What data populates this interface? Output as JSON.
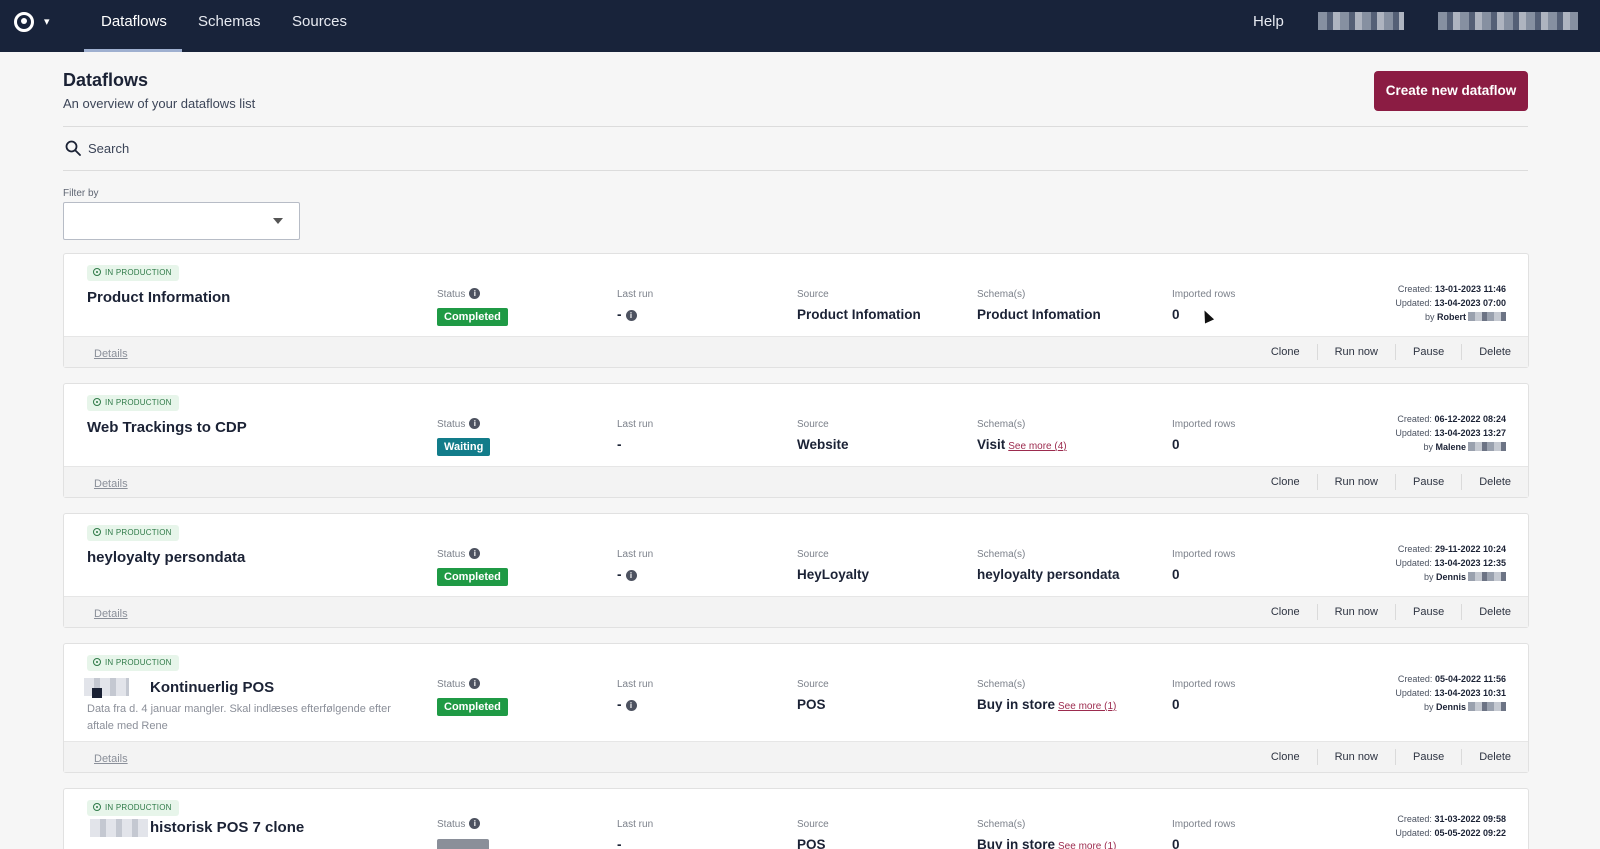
{
  "nav": {
    "tabs": [
      "Dataflows",
      "Schemas",
      "Sources"
    ],
    "help": "Help"
  },
  "header": {
    "title": "Dataflows",
    "subtitle": "An overview of your dataflows list",
    "create_button": "Create new dataflow"
  },
  "search": {
    "placeholder": "Search"
  },
  "filter": {
    "label": "Filter by",
    "value": ""
  },
  "labels": {
    "status": "Status",
    "last_run": "Last run",
    "source": "Source",
    "schemas": "Schema(s)",
    "imported_rows": "Imported rows",
    "created": "Created:",
    "updated": "Updated:",
    "by": "by",
    "details": "Details",
    "clone": "Clone",
    "run_now": "Run now",
    "pause": "Pause",
    "delete": "Delete",
    "in_production": "IN PRODUCTION"
  },
  "colors": {
    "nav_bg": "#18233a",
    "primary": "#8b1c43",
    "completed": "#1f9a45",
    "waiting": "#127c8a"
  },
  "dataflows": [
    {
      "name": "Product Information",
      "status": "Completed",
      "status_color": "#1f9a45",
      "last_run": "-",
      "source": "Product Infomation",
      "schema": "Product Infomation",
      "see_more": "",
      "imported_rows": "0",
      "created": "13-01-2023 11:46",
      "updated": "13-04-2023 07:00",
      "by": "Robert"
    },
    {
      "name": "Web Trackings to CDP",
      "status": "Waiting",
      "status_color": "#127c8a",
      "last_run": "-",
      "source": "Website",
      "schema": "Visit",
      "see_more": "See more (4)",
      "imported_rows": "0",
      "created": "06-12-2022 08:24",
      "updated": "13-04-2023 13:27",
      "by": "Malene"
    },
    {
      "name": "heyloyalty persondata",
      "status": "Completed",
      "status_color": "#1f9a45",
      "last_run": "-",
      "source": "HeyLoyalty",
      "schema": "heyloyalty persondata",
      "see_more": "",
      "imported_rows": "0",
      "created": "29-11-2022 10:24",
      "updated": "13-04-2023 12:35",
      "by": "Dennis"
    },
    {
      "name": "Kontinuerlig POS",
      "description": "Data fra d. 4 januar mangler. Skal indlæses efterfølgende efter aftale med Rene",
      "status": "Completed",
      "status_color": "#1f9a45",
      "last_run": "-",
      "source": "POS",
      "schema": "Buy in store",
      "see_more": "See more (1)",
      "imported_rows": "0",
      "created": "05-04-2022 11:56",
      "updated": "13-04-2023 10:31",
      "by": "Dennis"
    },
    {
      "name": "historisk POS 7 clone",
      "status": "",
      "status_color": "#8a8f99",
      "last_run": "-",
      "source": "POS",
      "schema": "Buy in store",
      "see_more": "See more (1)",
      "imported_rows": "0",
      "created": "31-03-2022 09:58",
      "updated": "05-05-2022 09:22",
      "by": ""
    }
  ]
}
